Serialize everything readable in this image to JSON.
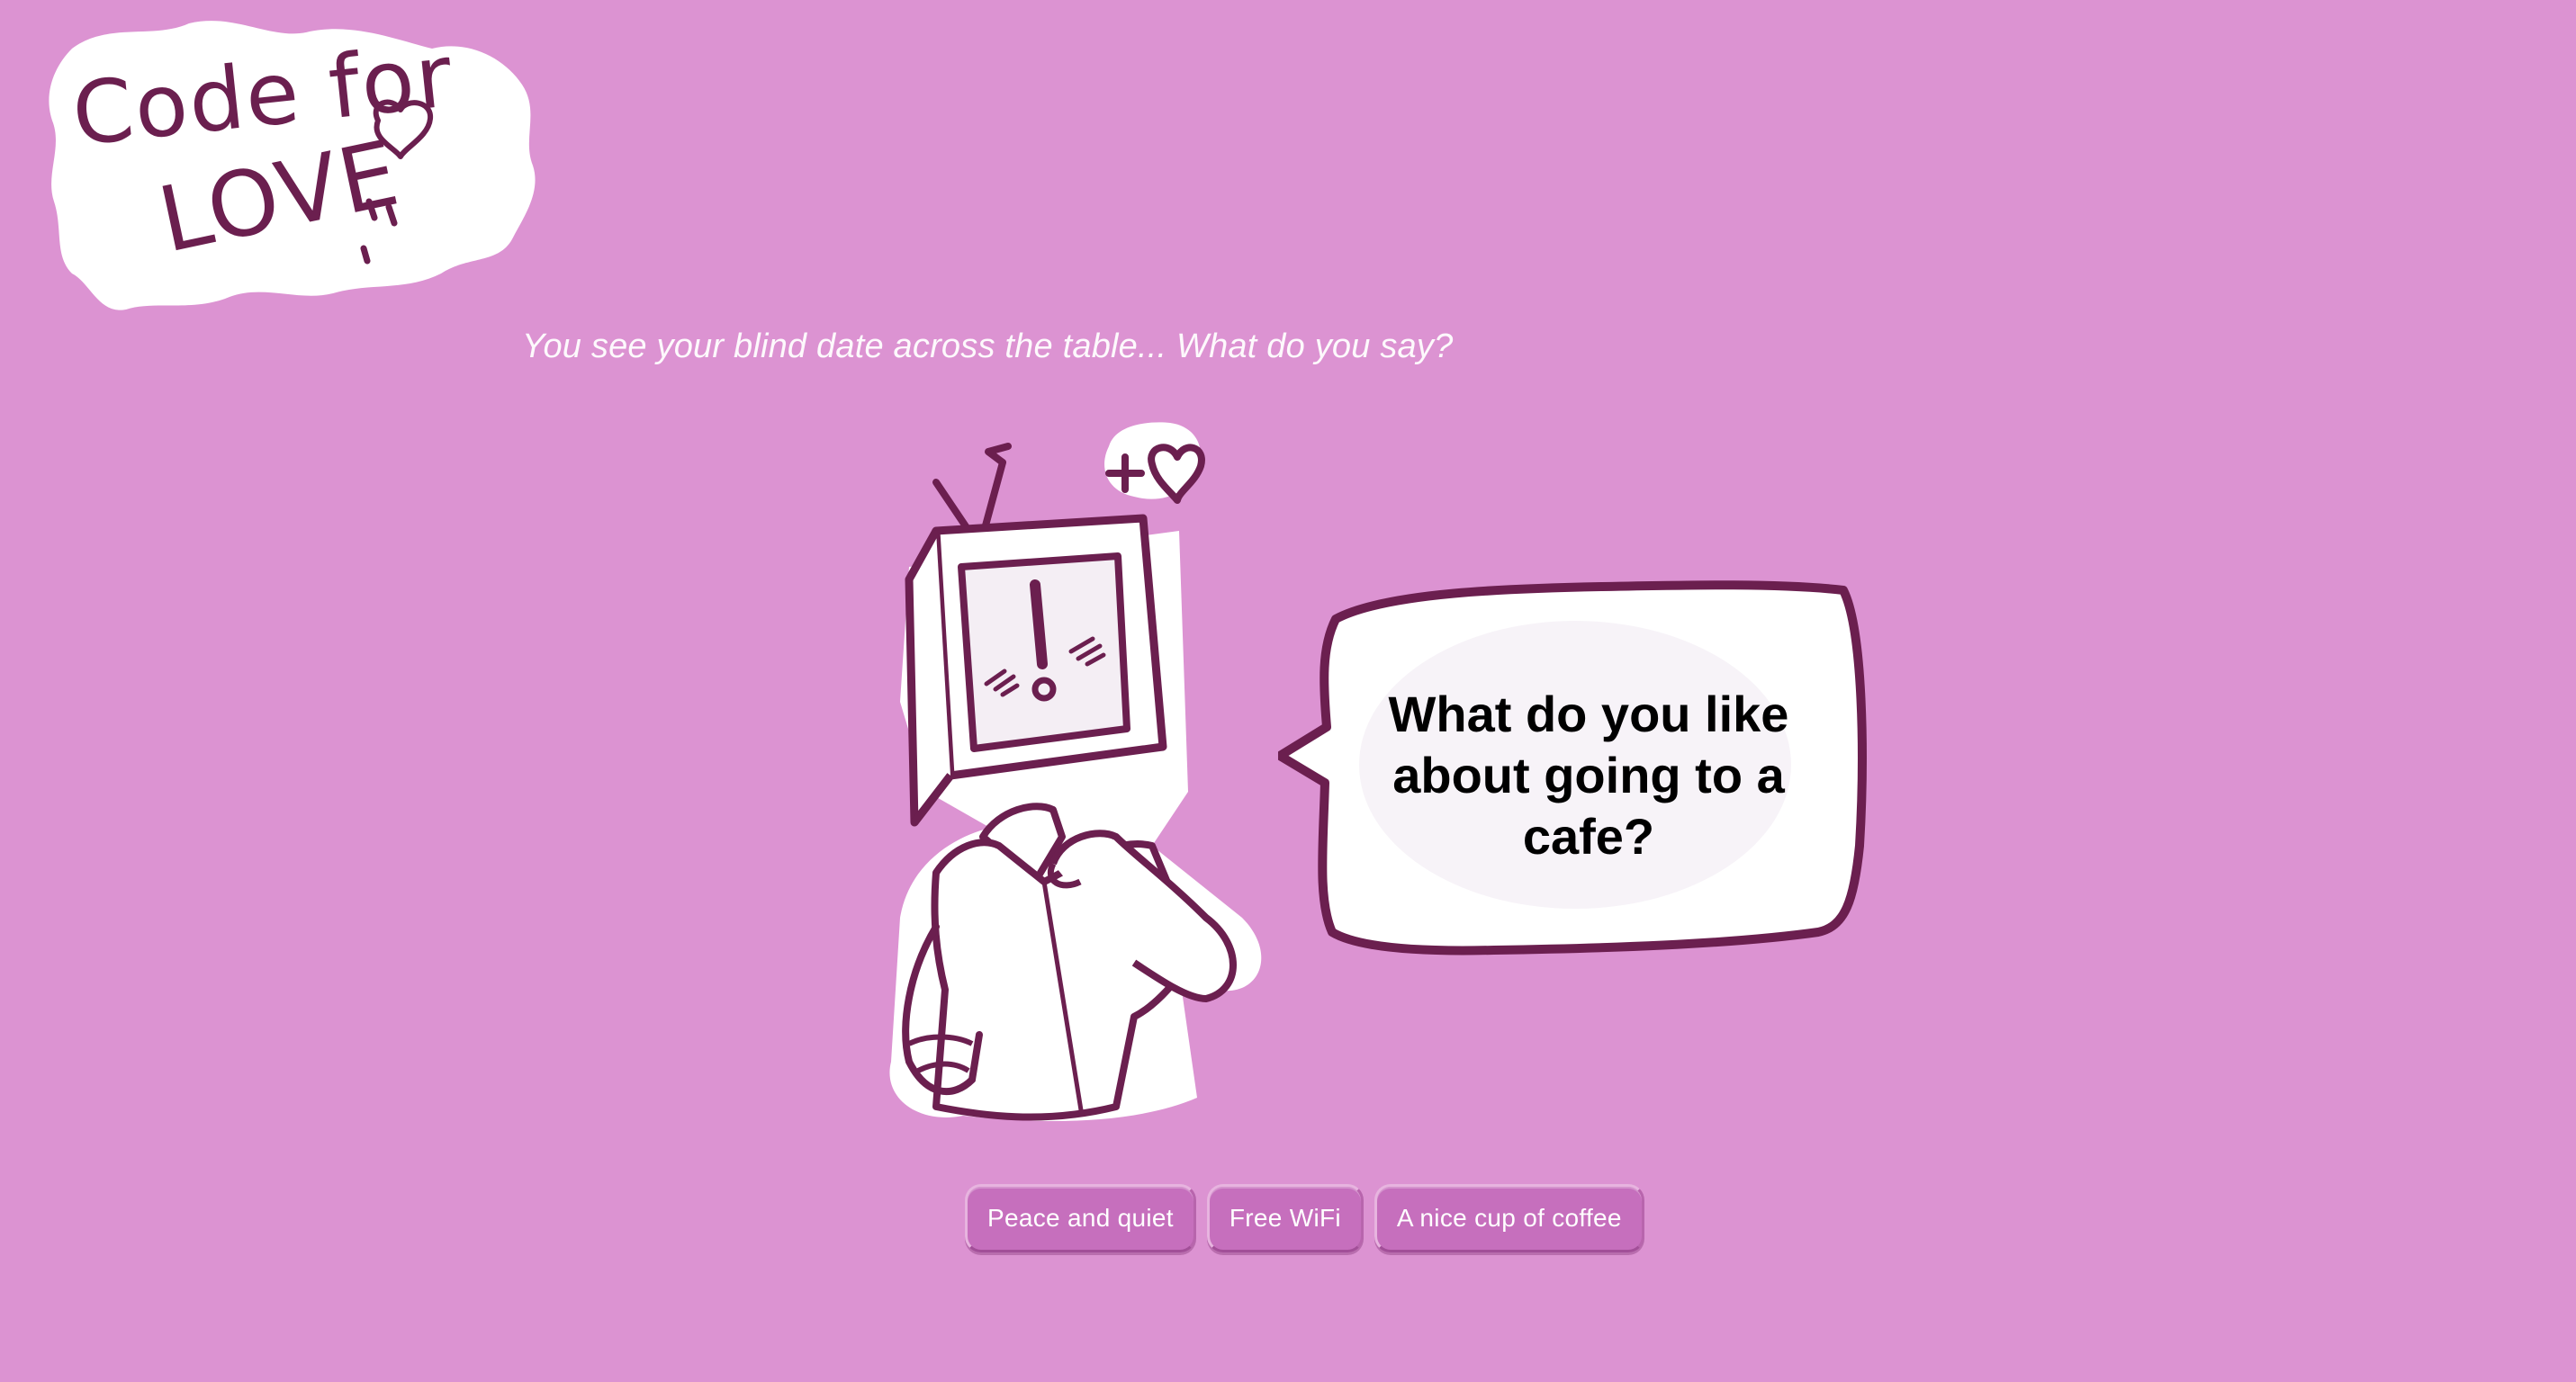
{
  "logo": {
    "line1": "Code for",
    "line2": "LOVE"
  },
  "prompt": "You see your blind date across the table... What do you say?",
  "character": {
    "icon": "tv-head-character-icon",
    "heart_badge": "+♥"
  },
  "bubble": {
    "question": "What do you like about going to a cafe?"
  },
  "answers": [
    {
      "label": "Peace and quiet"
    },
    {
      "label": "Free WiFi"
    },
    {
      "label": "A nice cup of coffee"
    }
  ],
  "colors": {
    "background": "#dc93d2",
    "ink": "#6b1f4f",
    "button": "#c66fbd",
    "paper": "#ffffff"
  }
}
